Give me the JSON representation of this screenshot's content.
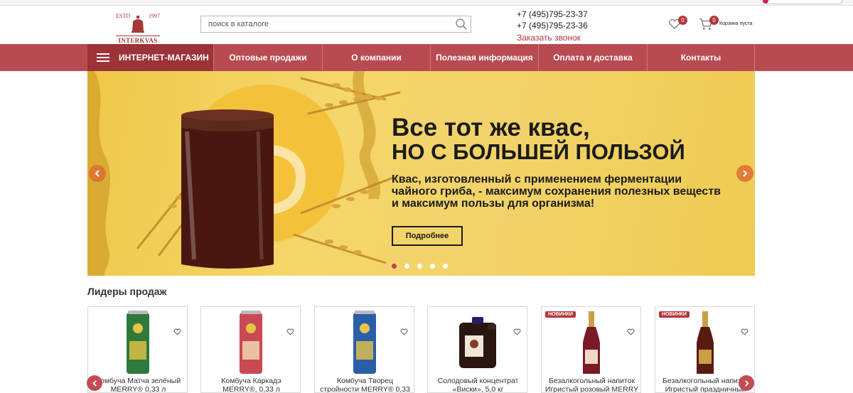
{
  "header": {
    "logo": {
      "estd": "ESTD",
      "year": "1997",
      "brand": "INTERKVAS"
    },
    "search": {
      "placeholder": "поиск в каталоге"
    },
    "phones": [
      "+7 (495)795-23-37",
      "+7 (495)795-23-36"
    ],
    "callback_label": "Заказать звонок",
    "favorites_count": "0",
    "cart": {
      "count": "0",
      "label": "Корзина пуста"
    }
  },
  "nav": {
    "shop_label": "ИНТЕРНЕТ-МАГАЗИН",
    "items": [
      {
        "label": "Оптовые продажи"
      },
      {
        "label": "О компании"
      },
      {
        "label": "Полезная информация"
      },
      {
        "label": "Оплата и доставка"
      },
      {
        "label": "Контакты"
      }
    ]
  },
  "banner": {
    "title_line1": "Все тот же квас,",
    "title_line2": "НО С БОЛЬШЕЙ ПОЛЬЗОЙ",
    "description": "Квас, изготовленный с применением ферментации чайного гриба, - максимум сохранения полезных веществ и максимум пользы для организма!",
    "button_label": "Подробнее",
    "slide_count": 5,
    "active_slide": 1
  },
  "section_title": "Лидеры продаж",
  "products": [
    {
      "name": "Комбуча Матча зелёный MERRY® 0,33 л",
      "badge": "",
      "can_color": "#2f7a3a"
    },
    {
      "name": "Комбуча Каркадэ MERRY®, 0,33 л",
      "badge": "",
      "can_color": "#c94a52"
    },
    {
      "name": "Комбуча Творец стройности MERRY® 0,33",
      "badge": "",
      "can_color": "#2a5fa8"
    },
    {
      "name": "Солодовый концентрат «Виски», 5,0 кг",
      "badge": "",
      "can_color": "#2a1510"
    },
    {
      "name": "Безалкогольный напиток Игристый розовый MERRY",
      "badge": "НОВИНКИ",
      "can_color": "#7a1a28"
    },
    {
      "name": "Безалкогольный напиток Игристый праздничный",
      "badge": "НОВИНКИ",
      "can_color": "#5a1a14"
    }
  ],
  "colors": {
    "brand": "#b84b51",
    "brand_dark": "#9b3338",
    "accent": "#b3343b"
  }
}
